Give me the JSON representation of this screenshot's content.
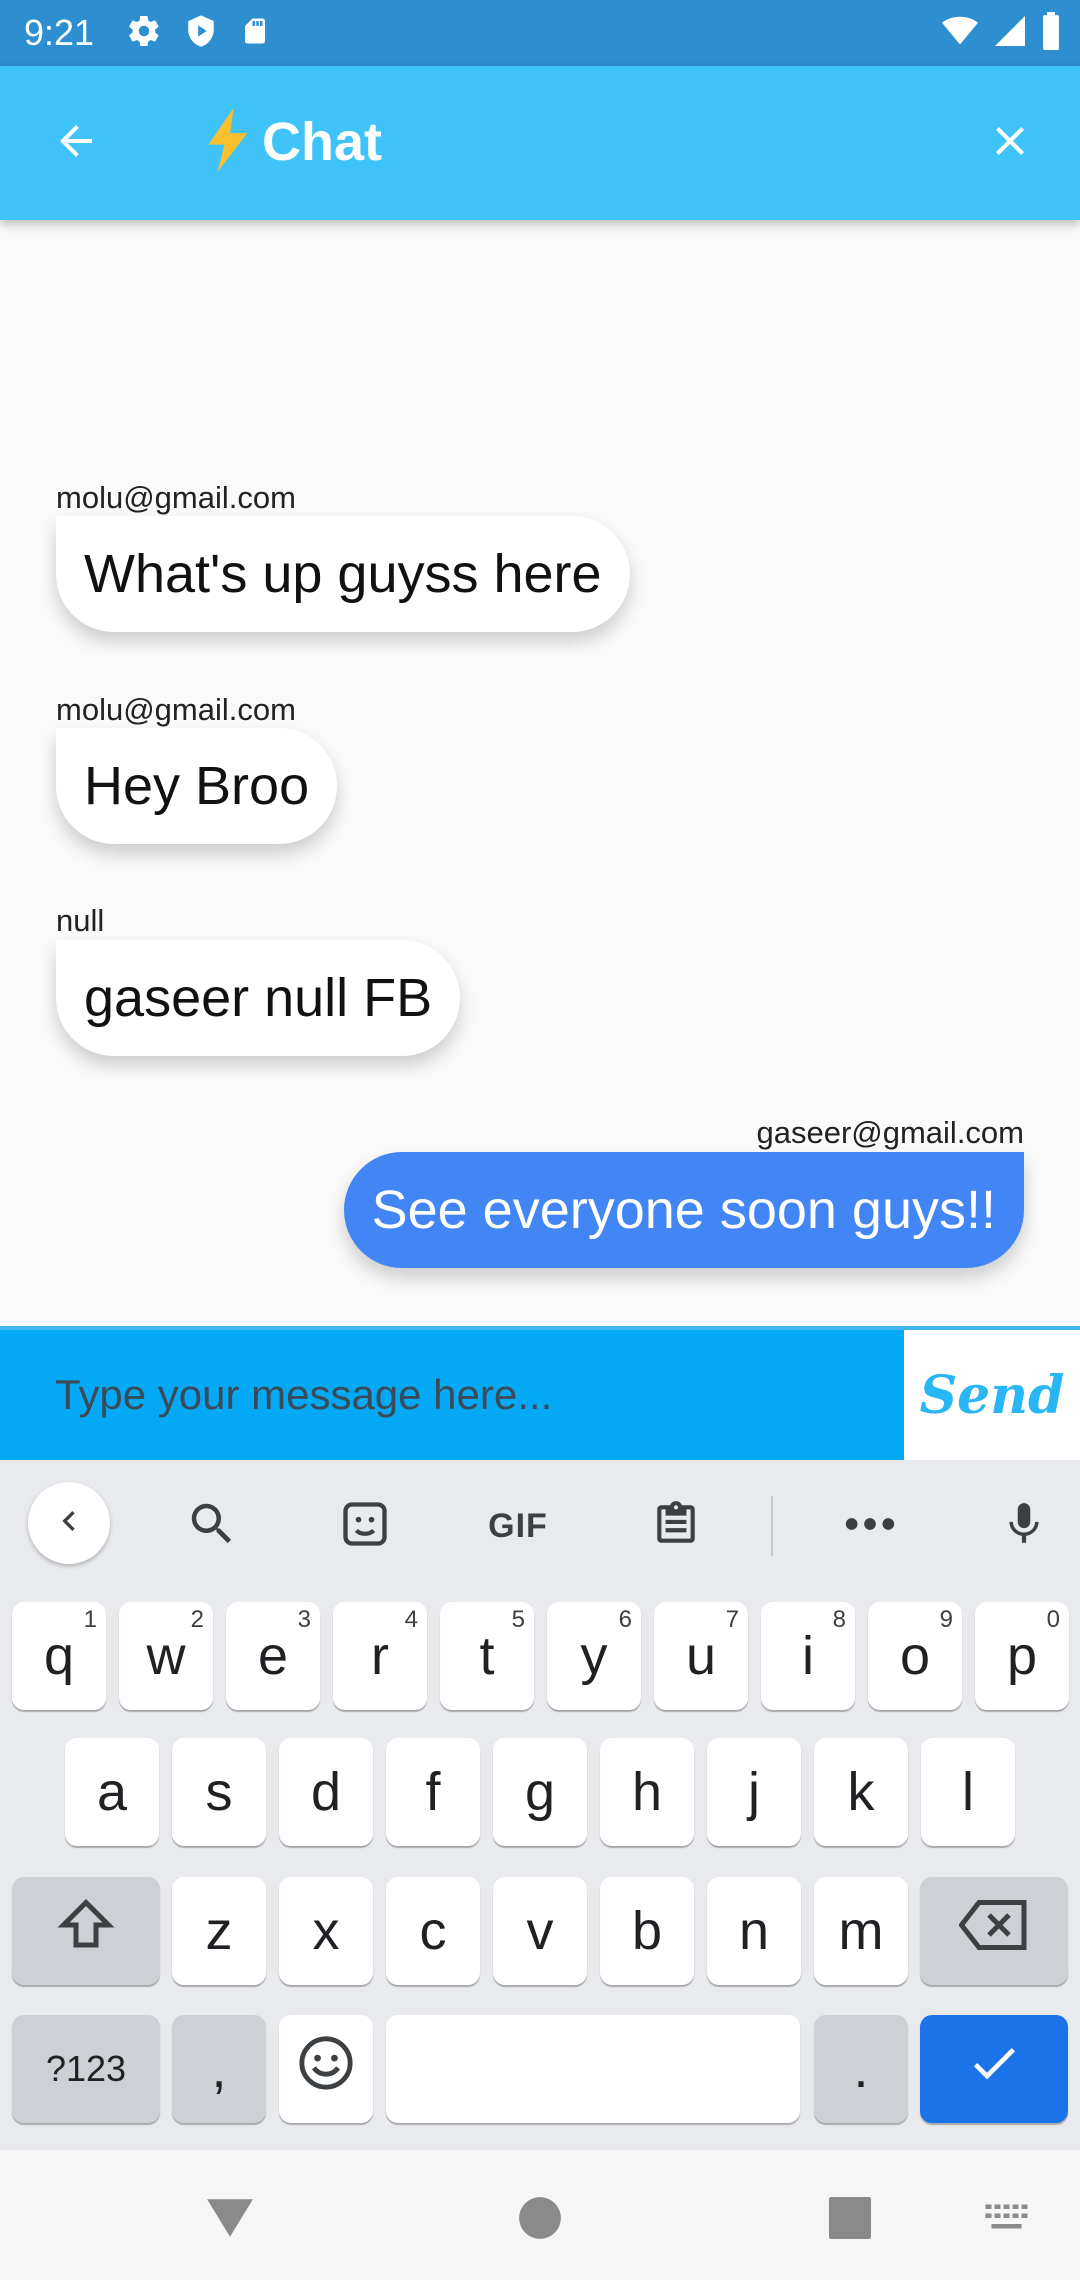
{
  "status_bar": {
    "time": "9:21",
    "icons_left": [
      "gear-icon",
      "shield-icon",
      "sd-card-icon"
    ],
    "icons_right": [
      "wifi-icon",
      "signal-icon",
      "battery-icon"
    ],
    "color": "#2d8fcf"
  },
  "app_bar": {
    "title": "Chat",
    "title_emoji": "lightning-icon",
    "back_icon": "arrow-left-icon",
    "close_icon": "close-icon",
    "color": "#40c3f9"
  },
  "messages": [
    {
      "sender": "molu@gmail.com",
      "text": "What's up guyss here",
      "side": "left"
    },
    {
      "sender": "molu@gmail.com",
      "text": "Hey Broo",
      "side": "left"
    },
    {
      "sender": "null",
      "text": "gaseer null FB",
      "side": "left"
    },
    {
      "sender": "gaseer@gmail.com",
      "text": "See everyone soon guys!!",
      "side": "right"
    }
  ],
  "composer": {
    "placeholder": "Type your message here...",
    "value": "",
    "send_label": "Send",
    "input_color": "#03a9f4",
    "send_color": "#29b6f6"
  },
  "keyboard": {
    "toolbar": [
      "chevron-left-icon",
      "search-icon",
      "sticker-icon",
      "GIF",
      "clipboard-icon",
      "more-icon",
      "mic-icon"
    ],
    "row1": [
      "q",
      "w",
      "e",
      "r",
      "t",
      "y",
      "u",
      "i",
      "o",
      "p"
    ],
    "row1_hints": [
      "1",
      "2",
      "3",
      "4",
      "5",
      "6",
      "7",
      "8",
      "9",
      "0"
    ],
    "row2": [
      "a",
      "s",
      "d",
      "f",
      "g",
      "h",
      "j",
      "k",
      "l"
    ],
    "row3": [
      "z",
      "x",
      "c",
      "v",
      "b",
      "n",
      "m"
    ],
    "symbols_label": "?123",
    "comma": ",",
    "period": ".",
    "space": "",
    "action_color": "#1a73e8"
  },
  "nav_bar": {
    "items": [
      "back-triangle-icon",
      "home-circle-icon",
      "recents-square-icon",
      "keyboard-switch-icon"
    ]
  }
}
